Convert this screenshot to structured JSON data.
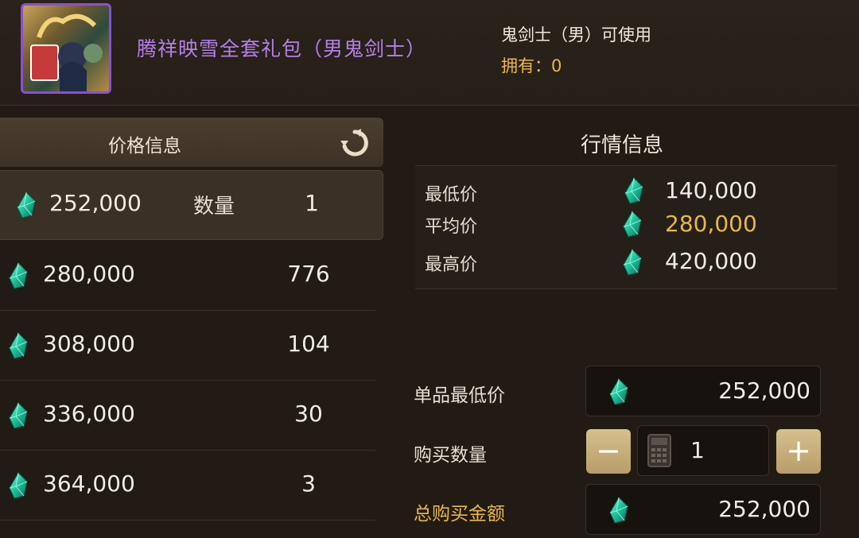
{
  "item": {
    "title": "腾祥映雪全套礼包（男鬼剑士）",
    "usable": "鬼剑士（男）可使用",
    "owned": "拥有：0"
  },
  "price_info": {
    "title": "价格信息",
    "qty_label": "数量",
    "rows": [
      {
        "price": "252,000",
        "qty": "1"
      },
      {
        "price": "280,000",
        "qty": "776"
      },
      {
        "price": "308,000",
        "qty": "104"
      },
      {
        "price": "336,000",
        "qty": "30"
      },
      {
        "price": "364,000",
        "qty": "3"
      }
    ]
  },
  "market": {
    "title": "行情信息",
    "min_label": "最低价",
    "min_value": "140,000",
    "avg_label": "平均价",
    "avg_value": "280,000",
    "max_label": "最高价",
    "max_value": "420,000"
  },
  "purchase": {
    "unit_label": "单品最低价",
    "unit_value": "252,000",
    "qty_label": "购买数量",
    "qty_value": "1",
    "minus": "−",
    "plus": "+",
    "total_label": "总购买金额",
    "total_value": "252,000"
  },
  "colors": {
    "accent_gold": "#e8b84a",
    "title_purple": "#b57fe8",
    "gem": "#1fc9a0"
  },
  "icons": [
    "item-icon",
    "refresh-icon",
    "gem-icon",
    "calculator-icon",
    "minus-icon",
    "plus-icon"
  ]
}
